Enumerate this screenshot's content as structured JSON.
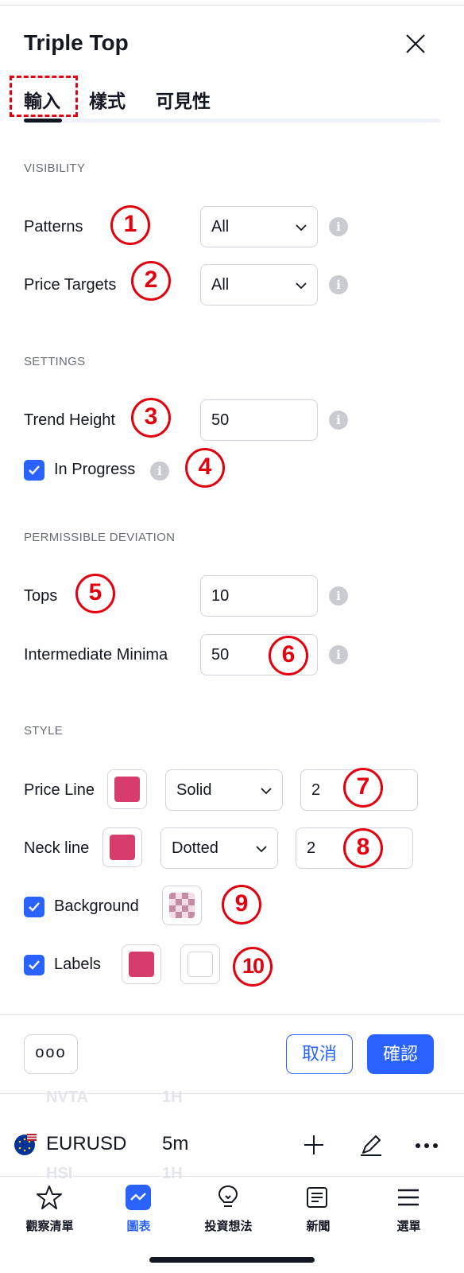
{
  "dialog": {
    "title": "Triple Top",
    "tabs": [
      {
        "label": "輸入",
        "active": true
      },
      {
        "label": "樣式",
        "active": false
      },
      {
        "label": "可見性",
        "active": false
      }
    ]
  },
  "visibility": {
    "heading": "VISIBILITY",
    "patterns": {
      "label": "Patterns",
      "value": "All"
    },
    "price_targets": {
      "label": "Price Targets",
      "value": "All"
    }
  },
  "settings": {
    "heading": "SETTINGS",
    "trend_height": {
      "label": "Trend Height",
      "value": "50"
    },
    "in_progress": {
      "label": "In Progress",
      "checked": true
    }
  },
  "deviation": {
    "heading": "PERMISSIBLE DEVIATION",
    "tops": {
      "label": "Tops",
      "value": "10"
    },
    "intermediate_minima": {
      "label": "Intermediate Minima",
      "value": "50"
    }
  },
  "style": {
    "heading": "STYLE",
    "price_line": {
      "label": "Price Line",
      "color": "#d63d6a",
      "line_style": "Solid",
      "width": "2"
    },
    "neck_line": {
      "label": "Neck line",
      "color": "#d63d6a",
      "line_style": "Dotted",
      "width": "2"
    },
    "background": {
      "label": "Background",
      "checked": true,
      "color": "#d8a5b8"
    },
    "labels": {
      "label": "Labels",
      "checked": true,
      "color": "#d63d6a",
      "text_color": "#ffffff"
    }
  },
  "annotations": [
    "1",
    "2",
    "3",
    "4",
    "5",
    "6",
    "7",
    "8",
    "9",
    "10"
  ],
  "footer": {
    "more_label": "ooo",
    "cancel_label": "取消",
    "confirm_label": "確認"
  },
  "ticker": {
    "symbol": "EURUSD",
    "interval": "5m",
    "ghost_above_symbol": "NVTA",
    "ghost_above_interval": "1H",
    "ghost_below_symbol": "HSI",
    "ghost_below_interval": "1H"
  },
  "bottom_nav": [
    {
      "label": "觀察清單",
      "icon": "star-icon",
      "active": false
    },
    {
      "label": "圖表",
      "icon": "chart-icon",
      "active": true
    },
    {
      "label": "投資想法",
      "icon": "lightbulb-icon",
      "active": false
    },
    {
      "label": "新聞",
      "icon": "news-icon",
      "active": false
    },
    {
      "label": "選單",
      "icon": "menu-icon",
      "active": false
    }
  ],
  "colors": {
    "accent": "#2962ff",
    "annotation": "#e3000f",
    "text": "#131722",
    "muted": "#6a6d78"
  }
}
